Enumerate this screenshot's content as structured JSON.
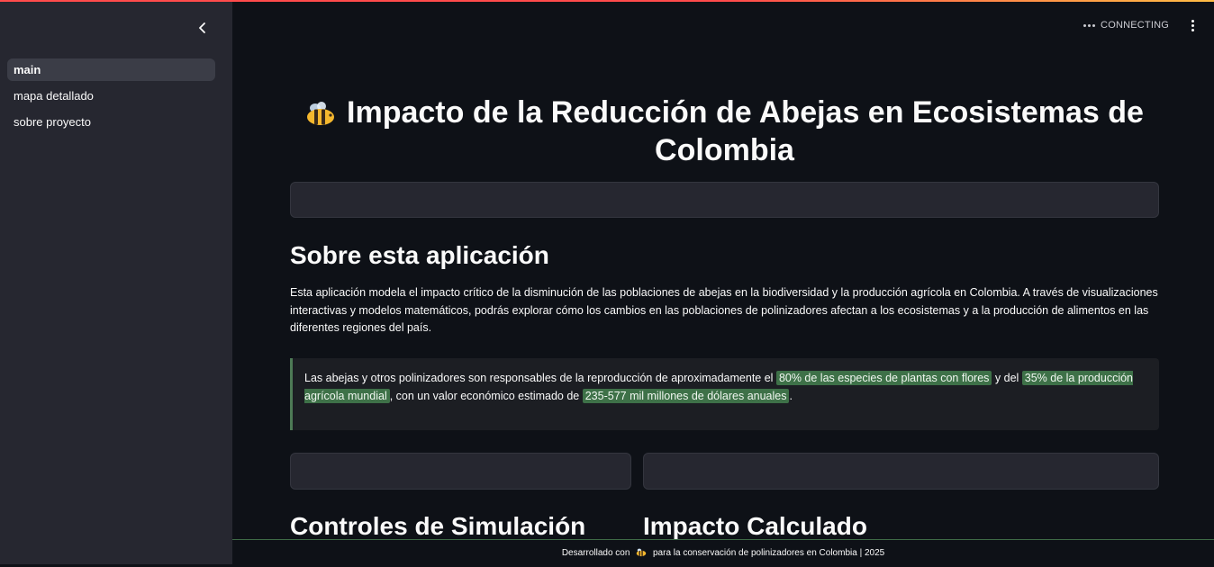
{
  "sidebar": {
    "items": [
      {
        "label": "main",
        "active": true
      },
      {
        "label": "mapa detallado",
        "active": false
      },
      {
        "label": "sobre proyecto",
        "active": false
      }
    ]
  },
  "header": {
    "status": "CONNECTING"
  },
  "page": {
    "title": "Impacto de la Reducción de Abejas en Ecosistemas de Colombia",
    "title_icon": "bee-icon",
    "about_heading": "Sobre esta aplicación",
    "about_text": "Esta aplicación modela el impacto crítico de la disminución de las poblaciones de abejas en la biodiversidad y la producción agrícola en Colombia. A través de visualizaciones interactivas y modelos matemáticos, podrás explorar cómo los cambios en las poblaciones de polinizadores afectan a los ecosistemas y a la producción de alimentos en las diferentes regiones del país.",
    "callout": {
      "part1": "Las abejas y otros polinizadores son responsables de la reproducción de aproximadamente el ",
      "highlight1": "80% de las especies de plantas con flores",
      "part2": " y del ",
      "highlight2": "35% de la producción agrícola mundial",
      "part3": ", con un valor económico estimado de ",
      "highlight3": "235-577 mil millones de dólares anuales",
      "part4": "."
    },
    "controls_heading": "Controles de Simulación",
    "impact_heading": "Impacto Calculado"
  },
  "footer": {
    "before": "Desarrollado con",
    "after": "para la conservación de polinizadores en Colombia | 2025"
  },
  "colors": {
    "background": "#0e1117",
    "sidebar": "#262730",
    "highlight": "#3e7148",
    "callout_border": "#4d7a55"
  }
}
